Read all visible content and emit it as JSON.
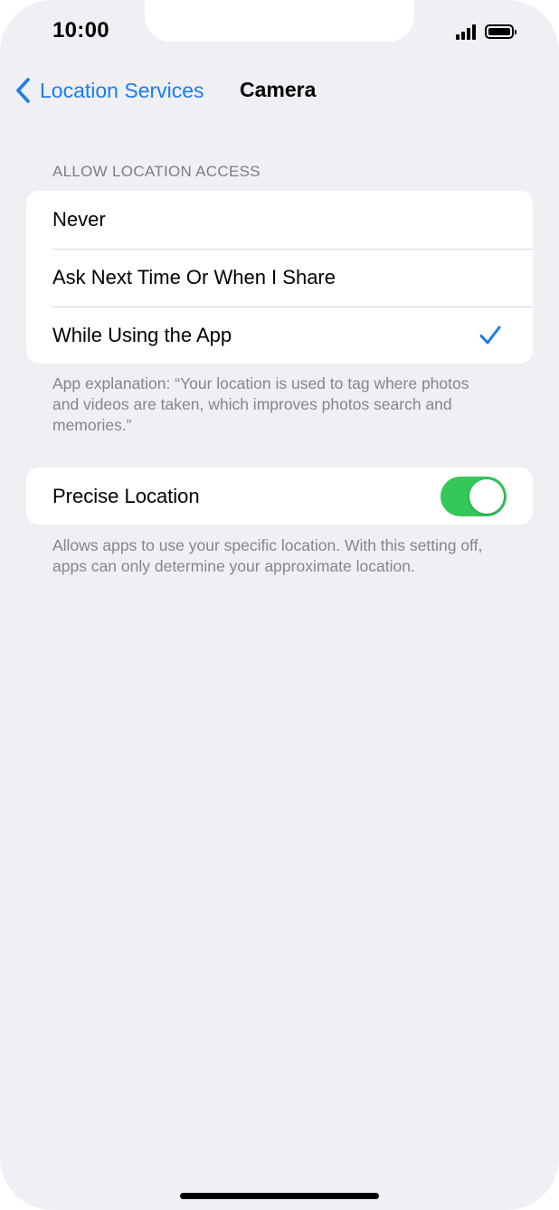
{
  "status_bar": {
    "time": "10:00",
    "signal_icon": "cellular-signal-icon",
    "battery_icon": "battery-icon"
  },
  "nav": {
    "back_label": "Location Services",
    "back_icon": "chevron-left-icon",
    "title": "Camera"
  },
  "access_section": {
    "header": "ALLOW LOCATION ACCESS",
    "options": [
      {
        "label": "Never",
        "selected": false
      },
      {
        "label": "Ask Next Time Or When I Share",
        "selected": false
      },
      {
        "label": "While Using the App",
        "selected": true
      }
    ],
    "selected_icon": "checkmark-icon",
    "footer": "App explanation: “Your location is used to tag where photos and videos are taken, which improves photos search and memories.”"
  },
  "precise_section": {
    "label": "Precise Location",
    "enabled": true,
    "footer": "Allows apps to use your specific location. With this setting off, apps can only determine your approximate location."
  },
  "colors": {
    "accent": "#1a7cf0",
    "toggle_on": "#34c759",
    "background": "#f0eff4"
  }
}
